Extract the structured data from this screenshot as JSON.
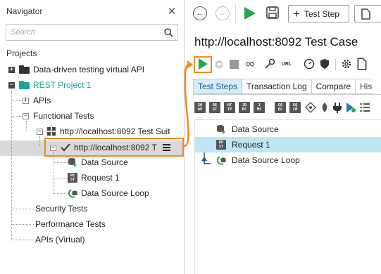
{
  "navigator": {
    "title": "Navigator",
    "close_glyph": "✕",
    "search_placeholder": "Search",
    "projects_label": "Projects",
    "tree": {
      "project1": "Data-driven testing virtual API",
      "project2": "REST Project 1",
      "apis": "APIs",
      "functional_tests": "Functional Tests",
      "test_suite": "http://localhost:8092 Test Suit",
      "test_case": "http://localhost:8092 T",
      "step_data_source": "Data Source",
      "step_request": "Request 1",
      "step_loop": "Data Source Loop",
      "security_tests": "Security Tests",
      "performance_tests": "Performance Tests",
      "apis_virtual": "APIs (Virtual)"
    }
  },
  "toolbar": {
    "test_step_label": "Test Step"
  },
  "editor": {
    "title": "http://localhost:8092 Test Case",
    "url_label": "URL",
    "tabs": [
      "Test Steps",
      "Transaction Log",
      "Compare",
      "His"
    ],
    "step_icons": [
      "SO AP",
      "RE ST",
      "HT TP",
      "JD BC",
      "J MS",
      "GQ QL",
      "GQ LM"
    ],
    "steps": [
      "Data Source",
      "Request 1",
      "Data Source Loop"
    ]
  },
  "colors": {
    "accent_orange": "#f28a1c",
    "teal": "#1aa3a3",
    "run_green": "#22a84a",
    "selected_row": "#bfe6f2"
  }
}
